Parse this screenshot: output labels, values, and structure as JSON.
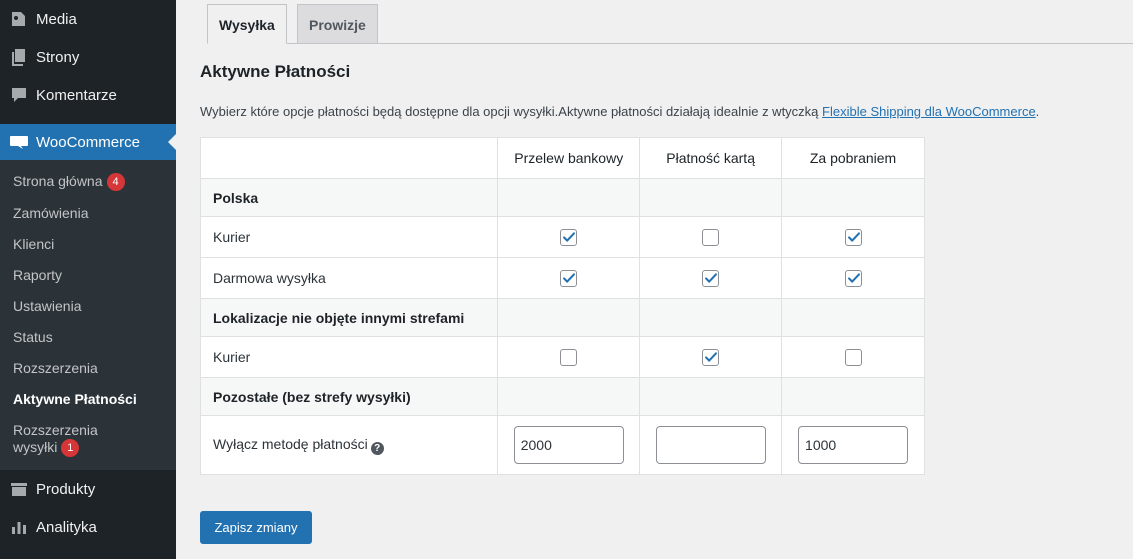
{
  "sidebar": {
    "top_items": [
      {
        "label": "Media",
        "icon": "media-icon"
      },
      {
        "label": "Strony",
        "icon": "pages-icon"
      },
      {
        "label": "Komentarze",
        "icon": "comments-icon"
      }
    ],
    "active": {
      "label": "WooCommerce",
      "icon": "woocommerce-icon"
    },
    "submenu": [
      {
        "label": "Strona główna",
        "badge": "4"
      },
      {
        "label": "Zamówienia"
      },
      {
        "label": "Klienci"
      },
      {
        "label": "Raporty"
      },
      {
        "label": "Ustawienia"
      },
      {
        "label": "Status"
      },
      {
        "label": "Rozszerzenia"
      },
      {
        "label": "Aktywne Płatności"
      },
      {
        "label": "Rozszerzenia wysyłki",
        "badge": "1"
      }
    ],
    "bottom_items": [
      {
        "label": "Produkty",
        "icon": "products-icon"
      },
      {
        "label": "Analityka",
        "icon": "analytics-icon"
      }
    ]
  },
  "tabs": [
    "Wysyłka",
    "Prowizje"
  ],
  "page": {
    "title": "Aktywne Płatności",
    "description": "Wybierz które opcje płatności będą dostępne dla opcji wysyłki.Aktywne płatności działają idealnie z wtyczką ",
    "link_text": "Flexible Shipping dla WooCommerce",
    "description_end": "."
  },
  "table": {
    "headers": [
      "Przelew bankowy",
      "Płatność kartą",
      "Za pobraniem"
    ],
    "groups": [
      {
        "name": "Polska",
        "rows": [
          {
            "label": "Kurier",
            "checks": [
              true,
              false,
              true
            ]
          },
          {
            "label": "Darmowa wysyłka",
            "checks": [
              true,
              true,
              true
            ]
          }
        ]
      },
      {
        "name": "Lokalizacje nie objęte innymi strefami",
        "rows": [
          {
            "label": "Kurier",
            "checks": [
              false,
              true,
              false
            ]
          }
        ]
      },
      {
        "name": "Pozostałe (bez strefy wysyłki)",
        "rows": []
      }
    ],
    "disable_label": "Wyłącz metodę płatności",
    "disable_values": [
      "2000",
      "",
      "1000"
    ]
  },
  "save_label": "Zapisz zmiany",
  "colors": {
    "accent": "#2271b1",
    "sidebar": "#1d2327",
    "badge": "#d63638"
  }
}
